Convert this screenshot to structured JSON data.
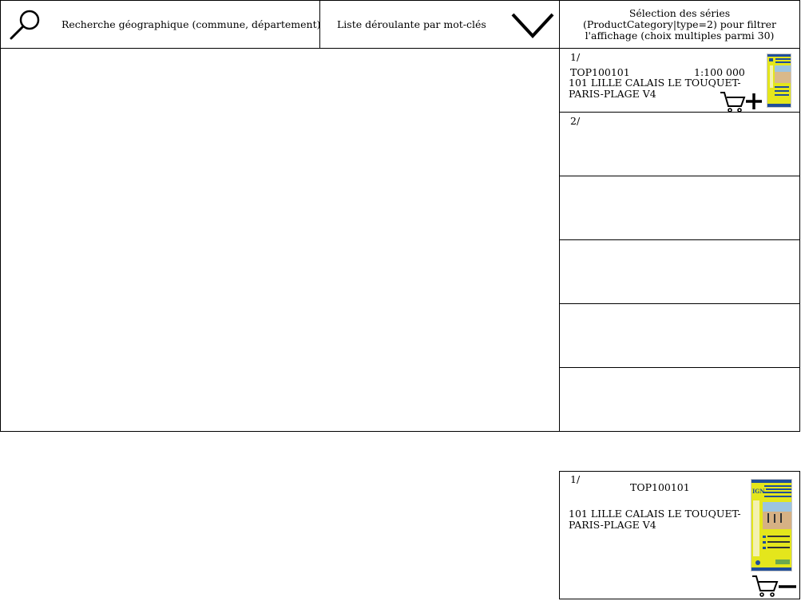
{
  "search": {
    "label": "Recherche géographique (commune, département)"
  },
  "keywords": {
    "label": "Liste déroulante par mot-clés"
  },
  "series_filter": {
    "label": "Sélection des séries (ProductCategory|type=2) pour filtrer l'affichage (choix multiples parmi 30)"
  },
  "results": [
    {
      "index": "1/",
      "code": "TOP100101",
      "scale": "1:100 000",
      "title_line1": "101 LILLE CALAIS LE TOUQUET-",
      "title_line2": "PARIS-PLAGE V4"
    },
    {
      "index": "2/"
    }
  ],
  "cart": {
    "index": "1/",
    "code": "TOP100101",
    "title_line1": "101 LILLE CALAIS LE TOUQUET-",
    "title_line2": "PARIS-PLAGE V4",
    "cover_brand": "IGN"
  },
  "icons": {
    "search": "magnifier-icon",
    "dropdown": "chevron-down-icon",
    "add_to_cart": "cart-plus-icon",
    "remove_from_cart": "cart-minus-icon"
  },
  "colors": {
    "border": "#000000",
    "cover_yellow": "#e4e61c",
    "cover_blue": "#1f4e9a"
  }
}
